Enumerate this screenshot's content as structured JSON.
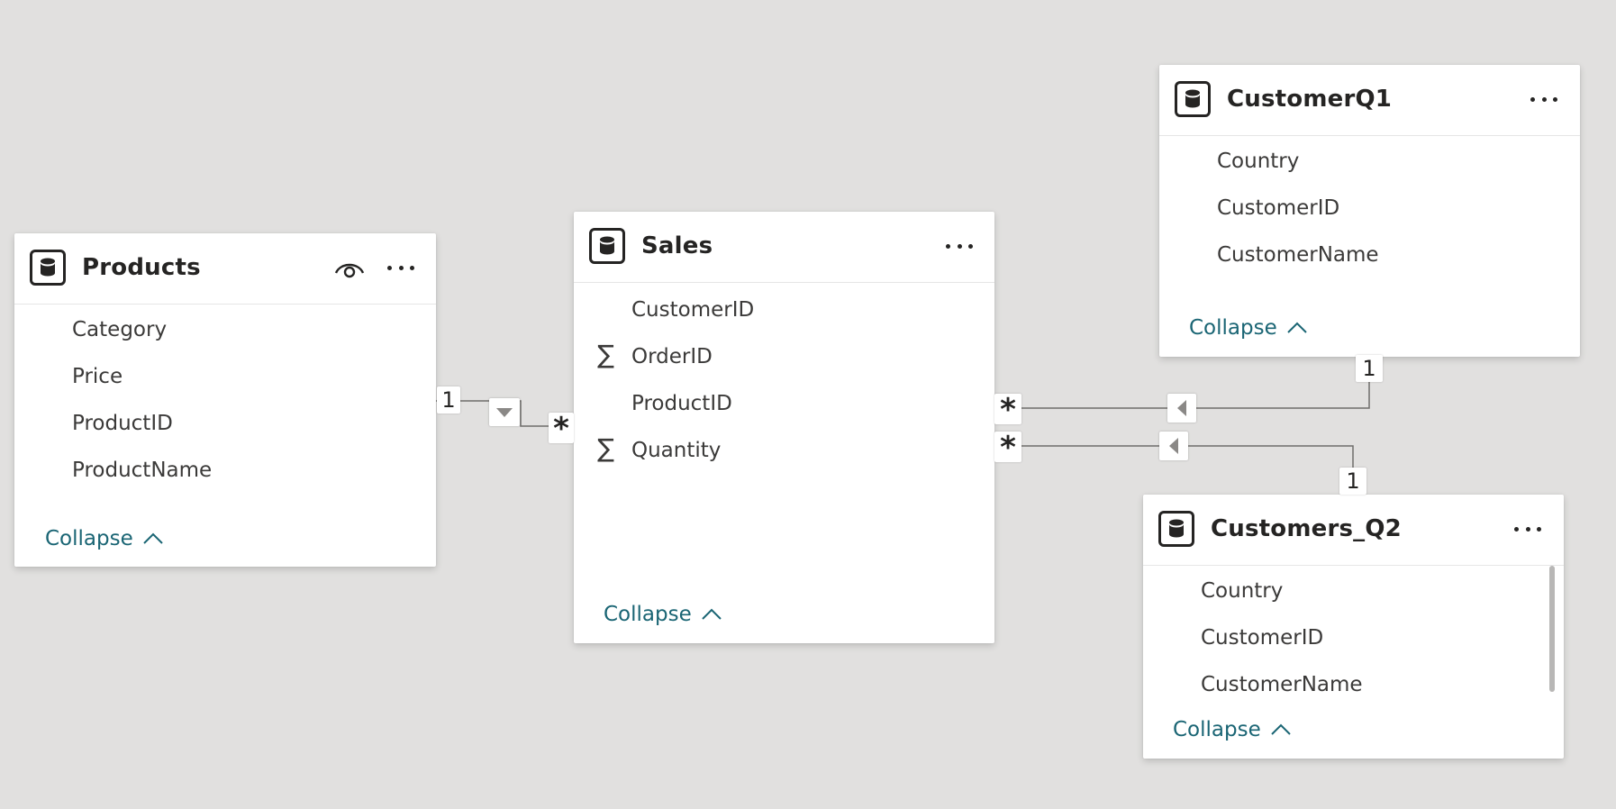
{
  "tables": {
    "products": {
      "title": "Products",
      "fields": [
        "Category",
        "Price",
        "ProductID",
        "ProductName"
      ],
      "collapse_label": "Collapse"
    },
    "sales": {
      "title": "Sales",
      "fields": [
        {
          "name": "CustomerID",
          "sigma": ""
        },
        {
          "name": "OrderID",
          "sigma": "∑"
        },
        {
          "name": "ProductID",
          "sigma": ""
        },
        {
          "name": "Quantity",
          "sigma": "∑"
        }
      ],
      "collapse_label": "Collapse"
    },
    "customerq1": {
      "title": "CustomerQ1",
      "fields": [
        "Country",
        "CustomerID",
        "CustomerName"
      ],
      "collapse_label": "Collapse"
    },
    "customers_q2": {
      "title": "Customers_Q2",
      "fields": [
        "Country",
        "CustomerID",
        "CustomerName"
      ],
      "collapse_label": "Collapse"
    }
  },
  "relationships": {
    "products_sales": {
      "one": "1",
      "many": "*"
    },
    "q1_sales": {
      "one": "1",
      "many": "*"
    },
    "q2_sales": {
      "one": "1",
      "many": "*"
    }
  },
  "colors": {
    "canvas": "#e1e0df",
    "card": "#ffffff",
    "collapse_link": "#1a6574",
    "text": "#3b3a39",
    "line": "#605e5c"
  },
  "icons": {
    "table": "database-icon",
    "more": "more-options-icon",
    "visibility": "eye-icon",
    "collapse": "chevron-up-icon",
    "measure": "sigma-icon"
  }
}
